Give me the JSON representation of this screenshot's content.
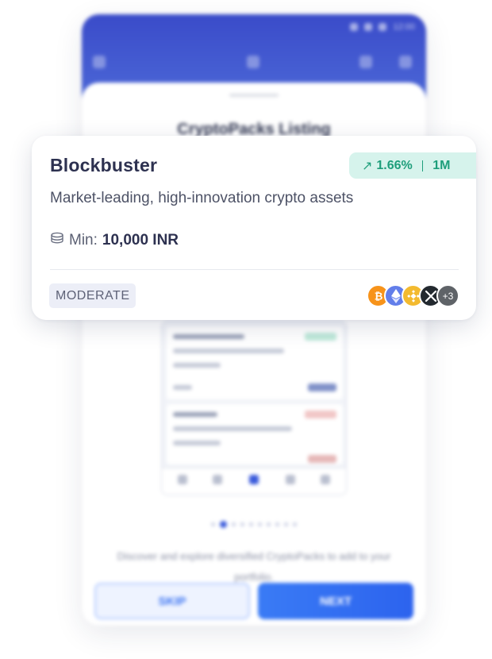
{
  "phone": {
    "title": "CryptoPacks Listing",
    "status_time": "12:00",
    "description": "Discover and explore diversified CryptoPacks to add to your portfolio.",
    "skip_label": "SKIP",
    "next_label": "NEXT",
    "pager": {
      "total": 10,
      "active": 1
    }
  },
  "card": {
    "title": "Blockbuster",
    "return": "1.66%",
    "period": "1M",
    "return_arrow_icon": "trend-up-arrow-icon",
    "description": "Market-leading, high-innovation crypto assets",
    "min_label": "Min:",
    "min_amount": "10,000 INR",
    "min_icon": "coins-stack-icon",
    "risk_label": "MODERATE",
    "assets": [
      {
        "name": "bitcoin-icon",
        "color": "#f7931a"
      },
      {
        "name": "ethereum-icon",
        "color": "#627eea"
      },
      {
        "name": "bnb-icon",
        "color": "#f3ba2f"
      },
      {
        "name": "xrp-icon",
        "color": "#23292f"
      }
    ],
    "more_assets": "+3",
    "colors": {
      "perf_bg": "#d6f3ec",
      "perf_text": "#1e9e7b",
      "title": "#2d3150"
    }
  }
}
